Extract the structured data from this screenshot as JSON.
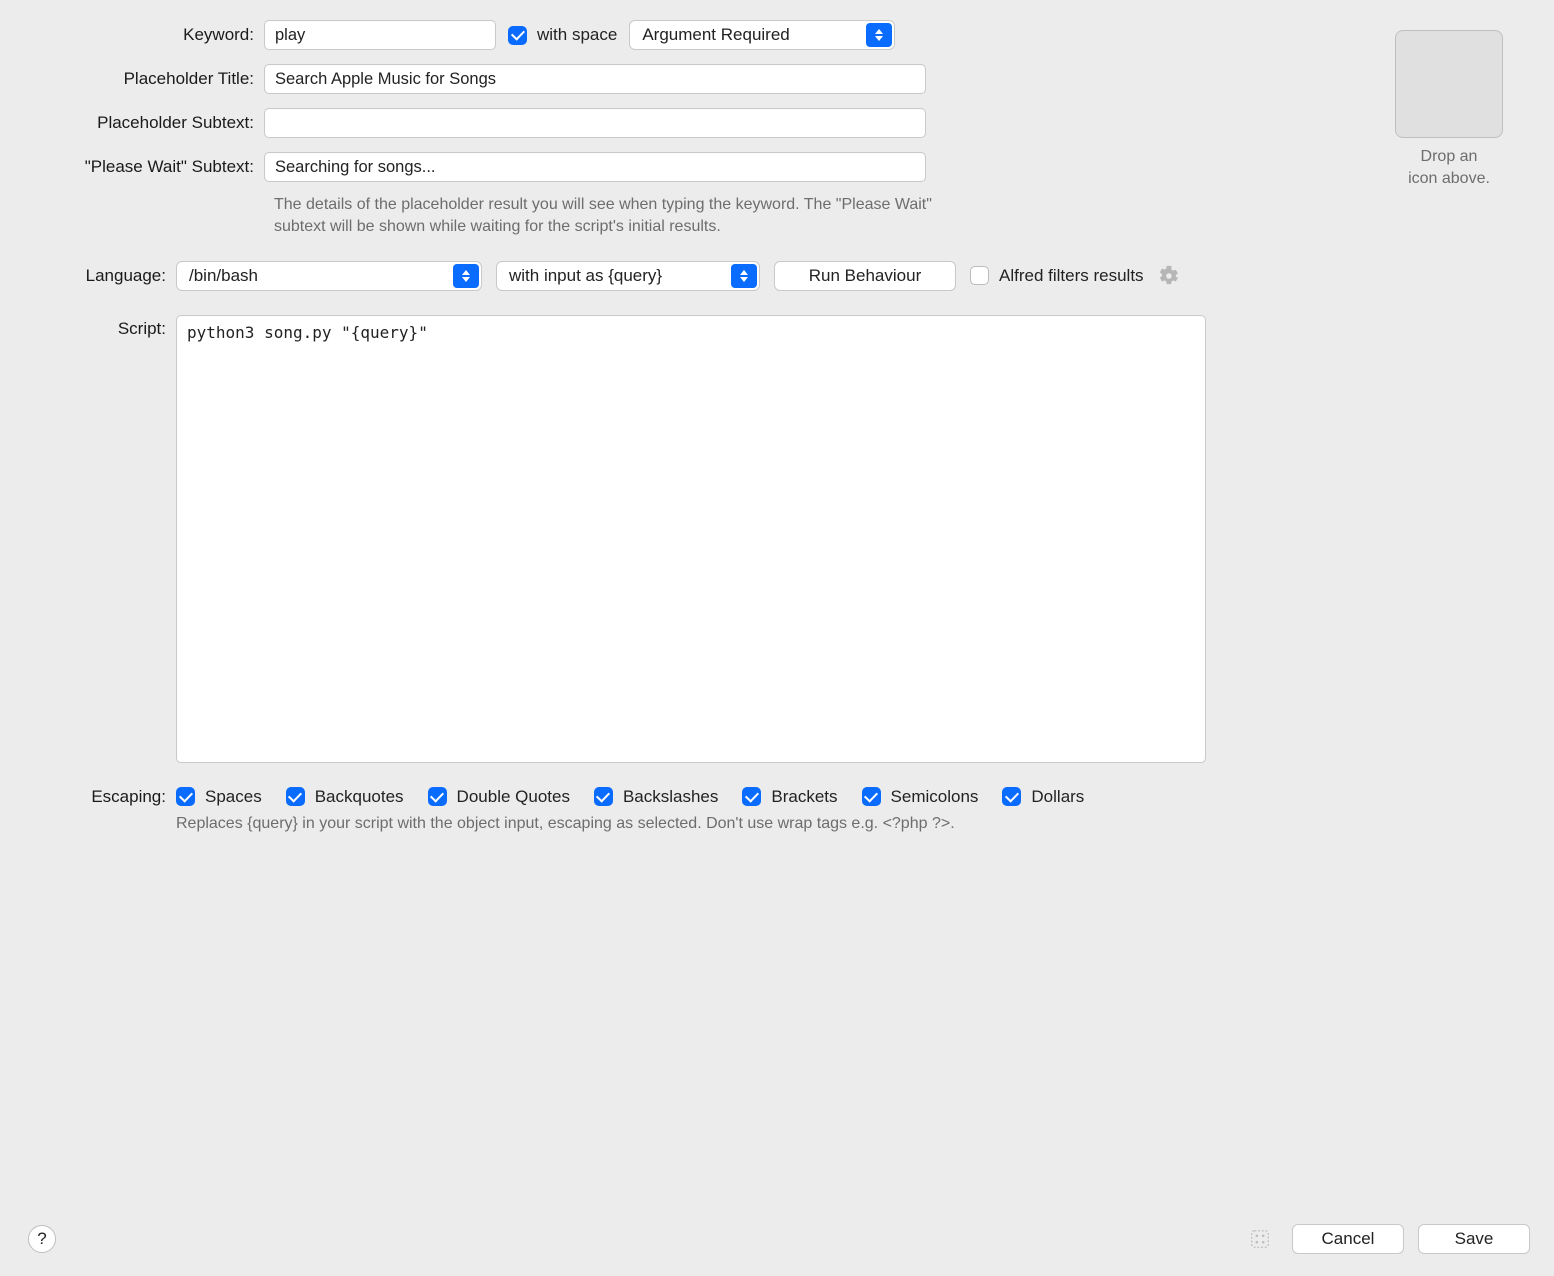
{
  "labels": {
    "keyword": "Keyword:",
    "with_space": "with space",
    "placeholder_title": "Placeholder Title:",
    "placeholder_subtext": "Placeholder Subtext:",
    "please_wait_subtext": "\"Please Wait\" Subtext:",
    "language": "Language:",
    "script": "Script:",
    "escaping": "Escaping:"
  },
  "values": {
    "keyword": "play",
    "with_space_checked": true,
    "argument_mode": "Argument Required",
    "placeholder_title": "Search Apple Music for Songs",
    "placeholder_subtext": "",
    "please_wait_subtext": "Searching for songs...",
    "language": "/bin/bash",
    "input_mode": "with input as {query}",
    "run_behaviour_label": "Run Behaviour",
    "alfred_filters_label": "Alfred filters results",
    "alfred_filters_checked": false,
    "script": "python3 song.py \"{query}\""
  },
  "help": {
    "placeholder": "The details of the placeholder result you will see when typing the keyword. The \"Please Wait\" subtext will be shown while waiting for the script's initial results.",
    "escaping": "Replaces {query} in your script with the object input, escaping as selected. Don't use wrap tags e.g. <?php ?>."
  },
  "icon_well": {
    "caption": "Drop an\nicon above."
  },
  "escaping_options": [
    {
      "key": "spaces",
      "label": "Spaces",
      "checked": true
    },
    {
      "key": "backquotes",
      "label": "Backquotes",
      "checked": true
    },
    {
      "key": "double_quotes",
      "label": "Double Quotes",
      "checked": true
    },
    {
      "key": "backslashes",
      "label": "Backslashes",
      "checked": true
    },
    {
      "key": "brackets",
      "label": "Brackets",
      "checked": true
    },
    {
      "key": "semicolons",
      "label": "Semicolons",
      "checked": true
    },
    {
      "key": "dollars",
      "label": "Dollars",
      "checked": true
    }
  ],
  "footer": {
    "cancel": "Cancel",
    "save": "Save",
    "help_symbol": "?"
  }
}
